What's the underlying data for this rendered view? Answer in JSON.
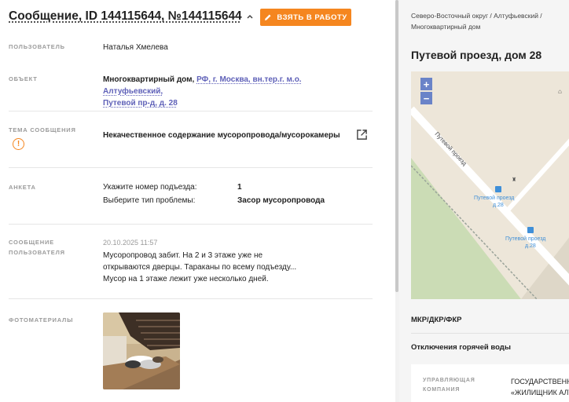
{
  "header": {
    "title": "Сообщение, ID 144115644, №144115644",
    "take_button": "ВЗЯТЬ В РАБОТУ"
  },
  "fields": {
    "user_label": "ПОЛЬЗОВАТЕЛЬ",
    "user_value": "Наталья Хмелева",
    "object_label": "ОБЪЕКТ",
    "object_type": "Многоквартирный дом,",
    "object_address_line1": "РФ, г. Москва, вн.тер.г. м.о. Алтуфьевский,",
    "object_address_line2": "Путевой пр-д, д. 28",
    "topic_label": "ТЕМА СООБЩЕНИЯ",
    "topic_value": "Некачественное содержание мусоропровода/мусорокамеры",
    "survey_label": "АНКЕТА",
    "survey": [
      {
        "question": "Укажите номер подъезда:",
        "answer": "1"
      },
      {
        "question": "Выберите тип проблемы:",
        "answer": "Засор мусоропровода"
      }
    ],
    "message_label_1": "СООБЩЕНИЕ",
    "message_label_2": "ПОЛЬЗОВАТЕЛЯ",
    "message_date": "20.10.2025 11:57",
    "message_line1": "Мусоропровод забит. На 2 и 3 этаже уже не",
    "message_line2": "открываются дверцы. Тараканы по всему подъезду...",
    "message_line3": "Мусор на 1 этаже лежит уже несколько дней.",
    "photos_label": "ФОТОМАТЕРИАЛЫ"
  },
  "right": {
    "breadcrumb_line1": "Северо-Восточный округ / Алтуфьевский /",
    "breadcrumb_line2": "Многоквартирный дом",
    "address_title": "Путевой проезд, дом 28",
    "map": {
      "street_label": "Путевой проезд",
      "stop1_name": "Путевой проезд",
      "stop1_sub": "д.28",
      "stop2_name": "Путевой проезд",
      "stop2_sub": "д.28",
      "zoom_in": "+",
      "zoom_out": "−"
    },
    "section1": "МКР/ДКР/ФКР",
    "section2": "Отключения горячей воды",
    "mgmt_label_1": "УПРАВЛЯЮЩАЯ",
    "mgmt_label_2": "КОМПАНИЯ",
    "mgmt_value_1": "ГОСУДАРСТВЕННОЕ",
    "mgmt_value_2": "«ЖИЛИЩНИК АЛТ"
  },
  "colors": {
    "accent": "#f5861f",
    "link": "#5f61b8",
    "map_zoom": "#6a83c8"
  }
}
